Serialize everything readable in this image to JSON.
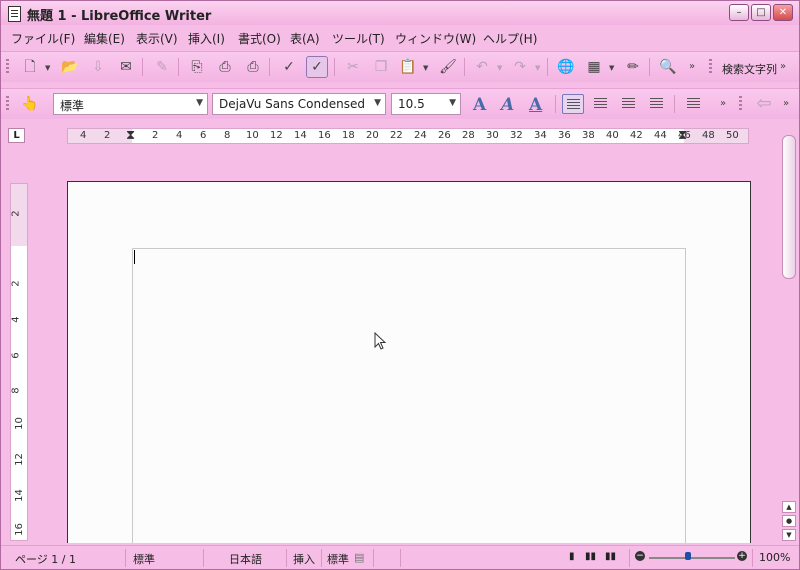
{
  "window": {
    "title": "無題 1 - LibreOffice Writer"
  },
  "menu": [
    "ファイル(F)",
    "編集(E)",
    "表示(V)",
    "挿入(I)",
    "書式(O)",
    "表(A)",
    "ツール(T)",
    "ウィンドウ(W)",
    "ヘルプ(H)"
  ],
  "toolbar1": {
    "search_label": "検索文字列"
  },
  "formatting": {
    "style": "標準",
    "font": "DejaVu Sans Condensed",
    "size": "10.5"
  },
  "ruler": {
    "h_numbers": [
      "4",
      "2",
      "2",
      "4",
      "6",
      "8",
      "10",
      "12",
      "14",
      "16",
      "18",
      "20",
      "22",
      "24",
      "26",
      "28",
      "30",
      "32",
      "34",
      "36",
      "38",
      "40",
      "42",
      "44",
      "46",
      "48",
      "50"
    ],
    "v_numbers": [
      "2",
      "2",
      "4",
      "6",
      "8",
      "10",
      "12",
      "14",
      "16"
    ]
  },
  "status": {
    "page": "ページ 1 / 1",
    "style": "標準",
    "language": "日本語",
    "insert_mode": "挿入",
    "selection_mode": "標準",
    "zoom": "100%"
  },
  "colors": {
    "chrome": "#f6bde6",
    "page": "#fdfcfd"
  }
}
